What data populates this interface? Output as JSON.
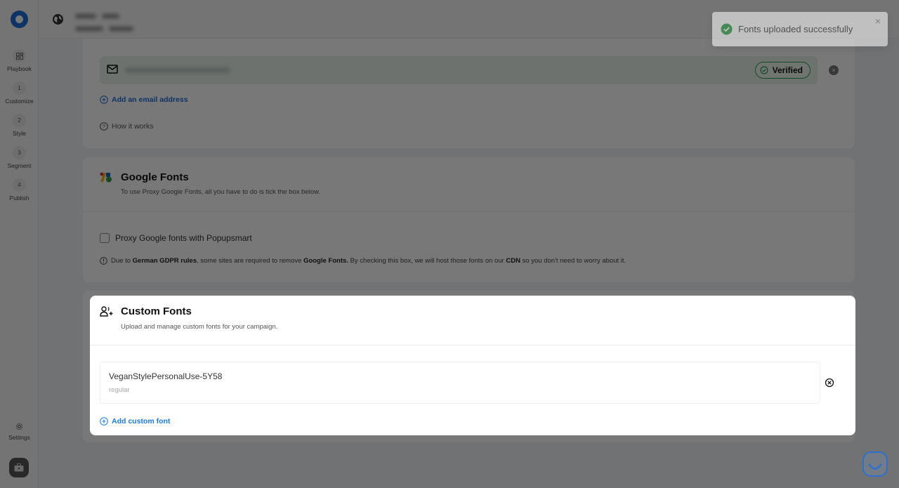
{
  "sidebar": {
    "items": [
      {
        "label": "Playbook",
        "icon": "grid-icon",
        "badge": ""
      },
      {
        "label": "Customize",
        "badge": "1"
      },
      {
        "label": "Style",
        "badge": "2"
      },
      {
        "label": "Segment",
        "badge": "3"
      },
      {
        "label": "Publish",
        "badge": "4"
      }
    ],
    "settings_label": "Settings"
  },
  "email_card": {
    "verified_label": "Verified",
    "add_email_label": "Add an email address",
    "how_it_works_label": "How it works"
  },
  "google_fonts": {
    "title": "Google Fonts",
    "subtitle": "To use Proxy Google Fonts, all you have to do is tick the box below.",
    "checkbox_label": "Proxy Google fonts with Popupsmart",
    "checkbox_checked": false,
    "note": {
      "p1": "Due to ",
      "b1": "German GDPR rules",
      "p2": ", some sites are required to remove ",
      "b2": "Google Fonts.",
      "p3": " By checking this box, we will host those fonts on our ",
      "b3": "CDN",
      "p4": " so you don't need to worry about it."
    }
  },
  "custom_fonts": {
    "title": "Custom Fonts",
    "subtitle": "Upload and manage custom fonts for your campaign.",
    "fonts": [
      {
        "name": "VeganStylePersonalUse-5Y58",
        "weight": "regular"
      }
    ],
    "add_label": "Add custom font"
  },
  "toast": {
    "message": "Fonts uploaded successfully",
    "status": "success"
  },
  "colors": {
    "accent": "#1e6fd9",
    "success": "#1f9d3a"
  }
}
